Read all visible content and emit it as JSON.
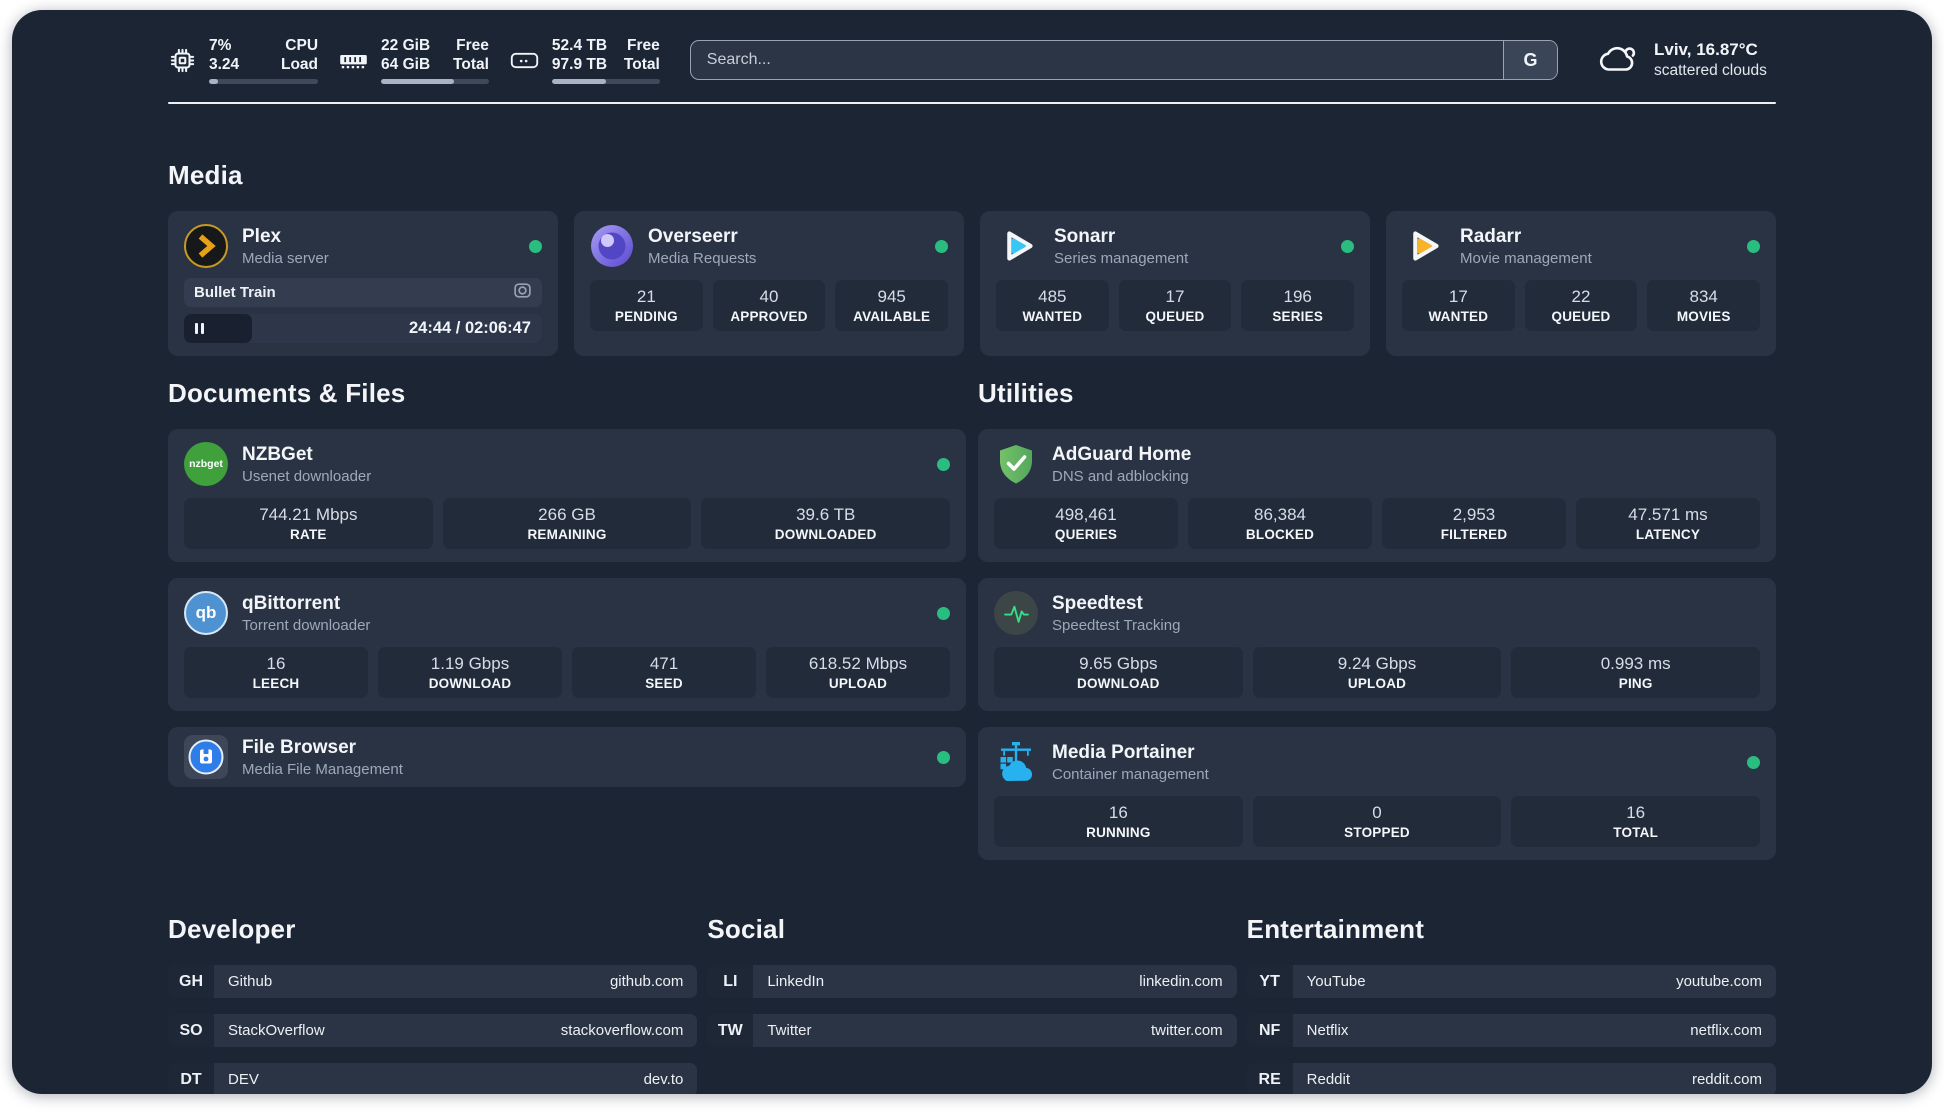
{
  "header": {
    "cpu": {
      "values": [
        "7%",
        "3.24"
      ],
      "labels": [
        "CPU",
        "Load"
      ],
      "progress_pct": 8
    },
    "memory": {
      "values": [
        "22 GiB",
        "64 GiB"
      ],
      "labels": [
        "Free",
        "Total"
      ],
      "progress_pct": 68
    },
    "storage": {
      "values": [
        "52.4 TB",
        "97.9 TB"
      ],
      "labels": [
        "Free",
        "Total"
      ],
      "progress_pct": 50
    },
    "search": {
      "placeholder": "Search...",
      "engine_label": "G"
    },
    "weather": {
      "location": "Lviv, 16.87°C",
      "condition": "scattered clouds"
    }
  },
  "sections": {
    "media": "Media",
    "documents": "Documents & Files",
    "utilities": "Utilities",
    "developer": "Developer",
    "social": "Social",
    "entertainment": "Entertainment"
  },
  "apps": {
    "plex": {
      "name": "Plex",
      "desc": "Media server",
      "now_playing": "Bullet Train",
      "time": "24:44 / 02:06:47",
      "progress_pct": 19
    },
    "overseerr": {
      "name": "Overseerr",
      "desc": "Media Requests",
      "stats": [
        {
          "value": "21",
          "label": "PENDING"
        },
        {
          "value": "40",
          "label": "APPROVED"
        },
        {
          "value": "945",
          "label": "AVAILABLE"
        }
      ]
    },
    "sonarr": {
      "name": "Sonarr",
      "desc": "Series management",
      "stats": [
        {
          "value": "485",
          "label": "WANTED"
        },
        {
          "value": "17",
          "label": "QUEUED"
        },
        {
          "value": "196",
          "label": "SERIES"
        }
      ]
    },
    "radarr": {
      "name": "Radarr",
      "desc": "Movie management",
      "stats": [
        {
          "value": "17",
          "label": "WANTED"
        },
        {
          "value": "22",
          "label": "QUEUED"
        },
        {
          "value": "834",
          "label": "MOVIES"
        }
      ]
    },
    "nzbget": {
      "name": "NZBGet",
      "desc": "Usenet downloader",
      "icon_text": "nzbget",
      "stats": [
        {
          "value": "744.21 Mbps",
          "label": "RATE"
        },
        {
          "value": "266 GB",
          "label": "REMAINING"
        },
        {
          "value": "39.6 TB",
          "label": "DOWNLOADED"
        }
      ]
    },
    "qbittorrent": {
      "name": "qBittorrent",
      "desc": "Torrent downloader",
      "icon_text": "qb",
      "stats": [
        {
          "value": "16",
          "label": "LEECH"
        },
        {
          "value": "1.19 Gbps",
          "label": "DOWNLOAD"
        },
        {
          "value": "471",
          "label": "SEED"
        },
        {
          "value": "618.52 Mbps",
          "label": "UPLOAD"
        }
      ]
    },
    "filebrowser": {
      "name": "File Browser",
      "desc": "Media File Management"
    },
    "adguard": {
      "name": "AdGuard Home",
      "desc": "DNS and adblocking",
      "stats": [
        {
          "value": "498,461",
          "label": "QUERIES"
        },
        {
          "value": "86,384",
          "label": "BLOCKED"
        },
        {
          "value": "2,953",
          "label": "FILTERED"
        },
        {
          "value": "47.571 ms",
          "label": "LATENCY"
        }
      ]
    },
    "speedtest": {
      "name": "Speedtest",
      "desc": "Speedtest Tracking",
      "stats": [
        {
          "value": "9.65 Gbps",
          "label": "DOWNLOAD"
        },
        {
          "value": "9.24 Gbps",
          "label": "UPLOAD"
        },
        {
          "value": "0.993 ms",
          "label": "PING"
        }
      ]
    },
    "portainer": {
      "name": "Media Portainer",
      "desc": "Container management",
      "stats": [
        {
          "value": "16",
          "label": "RUNNING"
        },
        {
          "value": "0",
          "label": "STOPPED"
        },
        {
          "value": "16",
          "label": "TOTAL"
        }
      ]
    }
  },
  "bookmarks": {
    "developer": [
      {
        "abbr": "GH",
        "name": "Github",
        "url": "github.com"
      },
      {
        "abbr": "SO",
        "name": "StackOverflow",
        "url": "stackoverflow.com"
      },
      {
        "abbr": "DT",
        "name": "DEV",
        "url": "dev.to"
      }
    ],
    "social": [
      {
        "abbr": "LI",
        "name": "LinkedIn",
        "url": "linkedin.com"
      },
      {
        "abbr": "TW",
        "name": "Twitter",
        "url": "twitter.com"
      }
    ],
    "entertainment": [
      {
        "abbr": "YT",
        "name": "YouTube",
        "url": "youtube.com"
      },
      {
        "abbr": "NF",
        "name": "Netflix",
        "url": "netflix.com"
      },
      {
        "abbr": "RE",
        "name": "Reddit",
        "url": "reddit.com"
      }
    ]
  },
  "colors": {
    "status_online": "#29bd7f"
  }
}
